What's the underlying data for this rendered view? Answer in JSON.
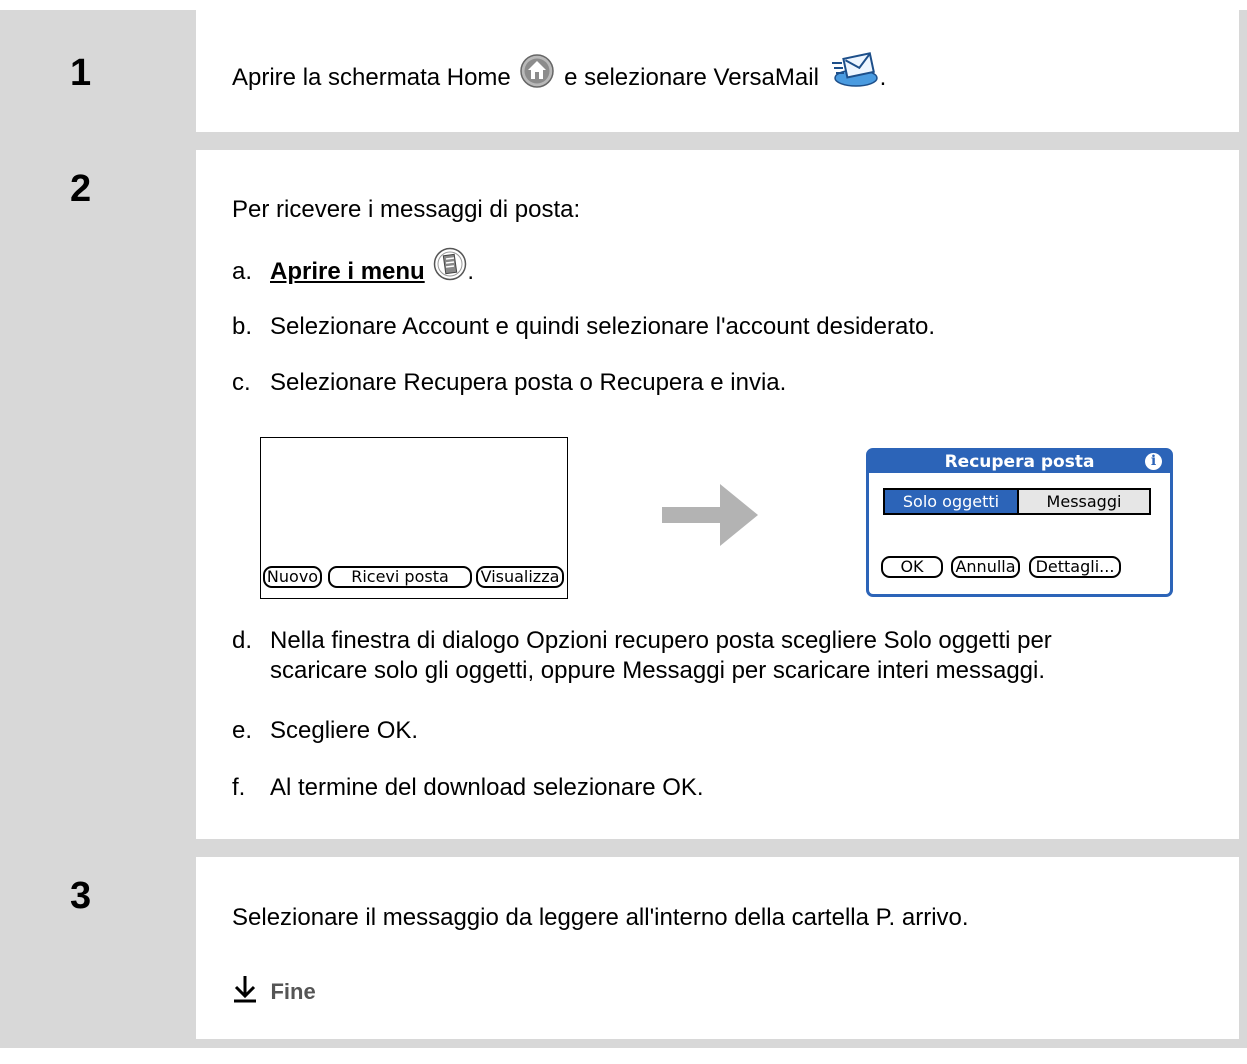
{
  "steps": [
    {
      "number": "1",
      "text_before": "Aprire la schermata Home",
      "text_middle": "e selezionare VersaMail",
      "text_after": "."
    },
    {
      "number": "2",
      "intro": "Per ricevere i messaggi di posta:",
      "items": [
        {
          "label": "a.",
          "link": "Aprire i menu",
          "after": "."
        },
        {
          "label": "b.",
          "text": "Selezionare Account e quindi selezionare l'account desiderato."
        },
        {
          "label": "c.",
          "text": "Selezionare Recupera posta o Recupera e invia."
        },
        {
          "label": "d.",
          "line1": "Nella finestra di dialogo Opzioni recupero posta scegliere Solo oggetti per",
          "line2": "scaricare solo gli oggetti, oppure Messaggi per scaricare interi messaggi."
        },
        {
          "label": "e.",
          "text": "Scegliere OK."
        },
        {
          "label": "f.",
          "text": "Al termine del download selezionare OK."
        }
      ]
    },
    {
      "number": "3",
      "text": "Selezionare il messaggio da leggere all'interno della cartella P. arrivo.",
      "done": "Fine"
    }
  ],
  "screen_left": {
    "buttons": [
      "Nuovo",
      "Ricevi posta",
      "Visualizza"
    ]
  },
  "dialog": {
    "title": "Recupera posta",
    "segment_selected": "Solo oggetti",
    "segment_other": "Messaggi",
    "buttons": [
      "OK",
      "Annulla",
      "Dettagli..."
    ]
  },
  "icons": {
    "home": "home-icon",
    "versamail": "versamail-icon",
    "menu": "menu-icon",
    "arrow": "right-arrow-icon",
    "info": "info-icon",
    "done": "down-arrow-icon"
  },
  "colors": {
    "frame": "#d8d8d8",
    "dialog_blue": "#2c64b8",
    "arrow_gray": "#b3b3b3"
  }
}
